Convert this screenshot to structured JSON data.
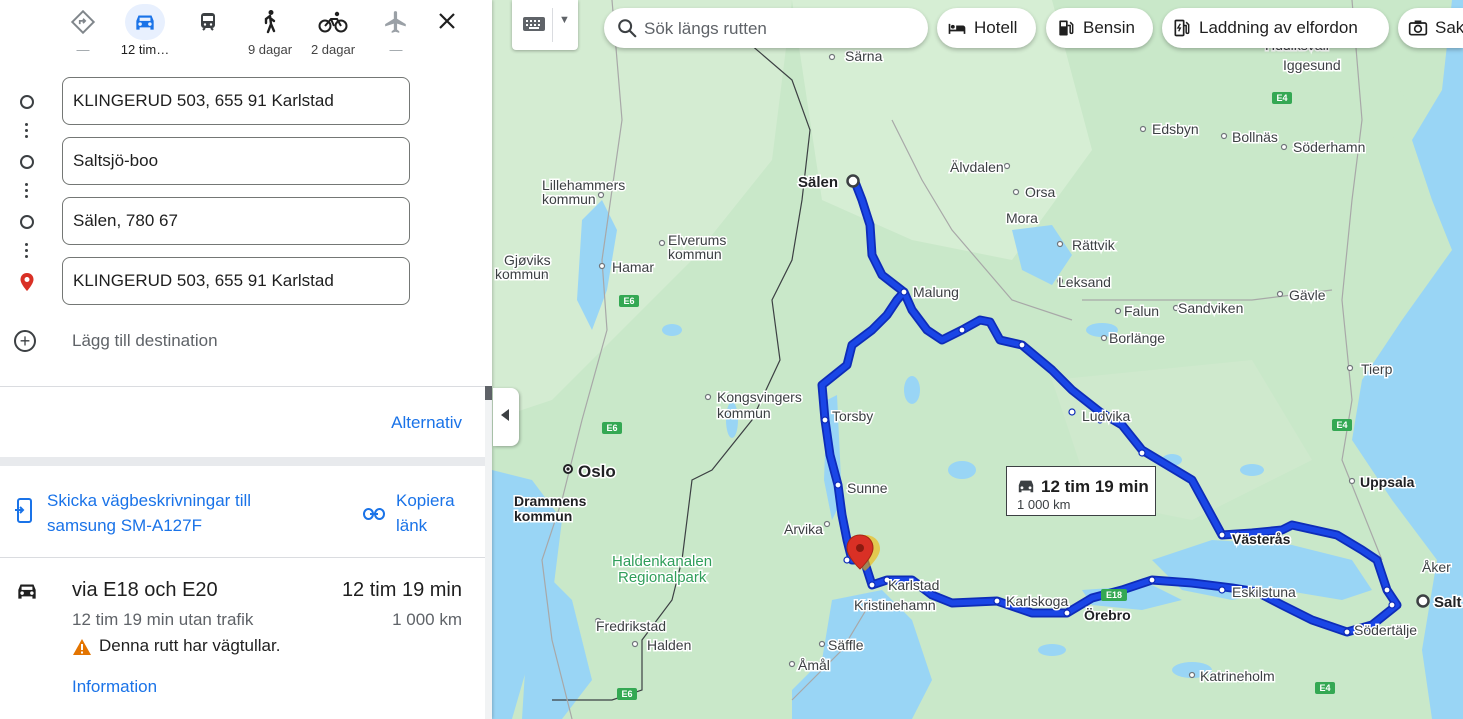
{
  "travel_modes": [
    {
      "name": "best",
      "label": "—"
    },
    {
      "name": "car",
      "label": "12 tim…"
    },
    {
      "name": "transit",
      "label": ""
    },
    {
      "name": "walk",
      "label": "9 dagar"
    },
    {
      "name": "bike",
      "label": "2 dagar"
    },
    {
      "name": "flight",
      "label": "—"
    }
  ],
  "waypoints": [
    "KLINGERUD 503, 655 91 Karlstad",
    "Saltsjö-boo",
    "Sälen, 780 67",
    "KLINGERUD 503, 655 91 Karlstad"
  ],
  "add_destination": "Lägg till destination",
  "alternatives": "Alternativ",
  "send_directions": "Skicka vägbeskrivningar till samsung SM-A127F",
  "copy_link": "Kopiera länk",
  "route": {
    "via": "via E18 och E20",
    "time": "12 tim 19 min",
    "no_traffic": "12 tim 19 min utan trafik",
    "distance": "1 000 km",
    "warning": "Denna rutt har vägtullar.",
    "info_link": "Information"
  },
  "map_search": {
    "placeholder": "Sök längs rutten"
  },
  "map_chips": [
    "Hotell",
    "Bensin",
    "Laddning av elfordon",
    "Sak"
  ],
  "route_box": {
    "time": "12 tim 19 min",
    "distance": "1 000 km"
  },
  "map_labels": {
    "salen": "Sälen",
    "oslo": "Oslo",
    "drammen": "Drammens kommun",
    "malung": "Malung",
    "torsby": "Torsby",
    "sunne": "Sunne",
    "arvika": "Arvika",
    "karlstad": "Karlstad",
    "kristinehamn": "Kristinehamn",
    "karlskoga": "Karlskoga",
    "orebro": "Örebro",
    "eskilstuna": "Eskilstuna",
    "vasteras": "Västerås",
    "sodertalje": "Södertälje",
    "salt": "Salt",
    "ludvika": "Ludvika",
    "borlange": "Borlänge",
    "falun": "Falun",
    "sandviken": "Sandviken",
    "gavle": "Gävle",
    "tierp": "Tierp",
    "uppsala": "Uppsala",
    "akers": "Åker",
    "katrineholm": "Katrineholm",
    "saffle": "Säffle",
    "amal": "Åmål",
    "fredrikstad": "Fredrikstad",
    "halden": "Halden",
    "haldenkanalen": "Haldenkanalen Regionalpark",
    "kongsvingers": "Kongsvingers kommun",
    "elverums": "Elverums kommun",
    "hamar": "Hamar",
    "gjoviks": "Gjøviks kommun",
    "lillehammers": "Lillehammers kommun",
    "sarna": "Särna",
    "alvdalen": "Älvdalen",
    "orsa": "Orsa",
    "mora": "Mora",
    "rattvik": "Rättvik",
    "leksand": "Leksand",
    "edsbyn": "Edsbyn",
    "bollnas": "Bollnäs",
    "soderhamn": "Söderhamn",
    "iggesund": "Iggesund",
    "hudiksvall": "Hudiksvall"
  },
  "road_shields": [
    "E4",
    "E6",
    "E18"
  ],
  "colors": {
    "route": "#1a46e6",
    "route_edge": "#0e2cb8",
    "water": "#99d5f5",
    "land": "#c9e8c9",
    "accent": "#1a73e8",
    "pin": "#d93025"
  }
}
